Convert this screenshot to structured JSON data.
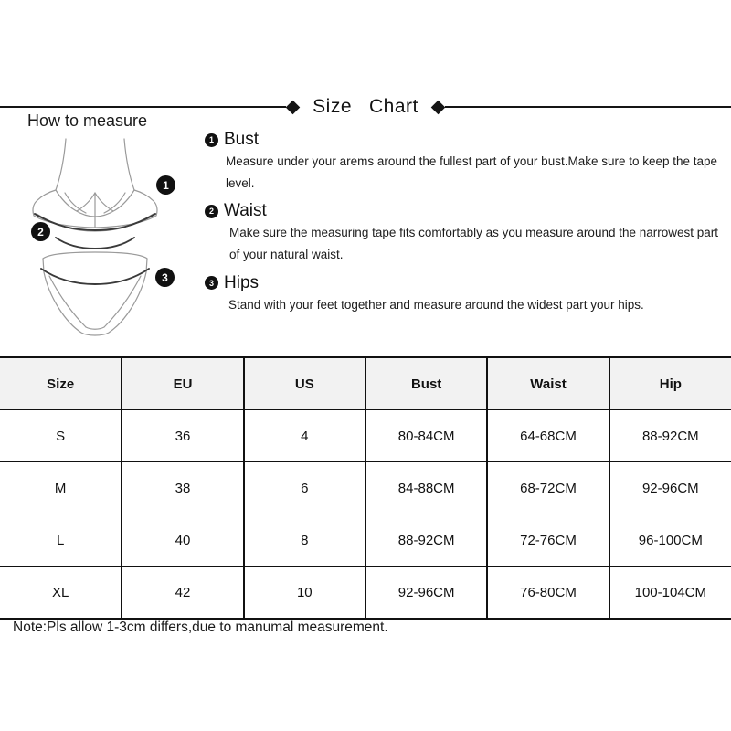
{
  "header": {
    "title": "Size   Chart",
    "left_diamond_icon": "diamond-icon",
    "right_diamond_icon": "diamond-icon"
  },
  "how_to_measure": {
    "label": "How to measure",
    "diagram_badges": [
      {
        "number": "1",
        "meaning": "bust"
      },
      {
        "number": "2",
        "meaning": "waist"
      },
      {
        "number": "3",
        "meaning": "hips"
      }
    ]
  },
  "instructions": [
    {
      "number": "1",
      "title": "Bust",
      "body": "Measure under your arems around the fullest part of your bust.Make sure to keep the tape level."
    },
    {
      "number": "2",
      "title": "Waist",
      "body": "Make sure the measuring tape fits comfortably as you measure around the narrowest part of your natural waist."
    },
    {
      "number": "3",
      "title": "Hips",
      "body": "Stand with your feet together and measure around the widest part your hips."
    }
  ],
  "table": {
    "columns": [
      "Size",
      "EU",
      "US",
      "Bust",
      "Waist",
      "Hip"
    ],
    "rows": [
      [
        "S",
        "36",
        "4",
        "80-84CM",
        "64-68CM",
        "88-92CM"
      ],
      [
        "M",
        "38",
        "6",
        "84-88CM",
        "68-72CM",
        "92-96CM"
      ],
      [
        "L",
        "40",
        "8",
        "88-92CM",
        "72-76CM",
        "96-100CM"
      ],
      [
        "XL",
        "42",
        "10",
        "92-96CM",
        "76-80CM",
        "100-104CM"
      ]
    ]
  },
  "note": "Note:Pls allow 1-3cm differs,due to manumal measurement.",
  "colors": {
    "ink": "#111111",
    "header_fill": "#f2f2f2",
    "line": "#9a9a9a"
  }
}
